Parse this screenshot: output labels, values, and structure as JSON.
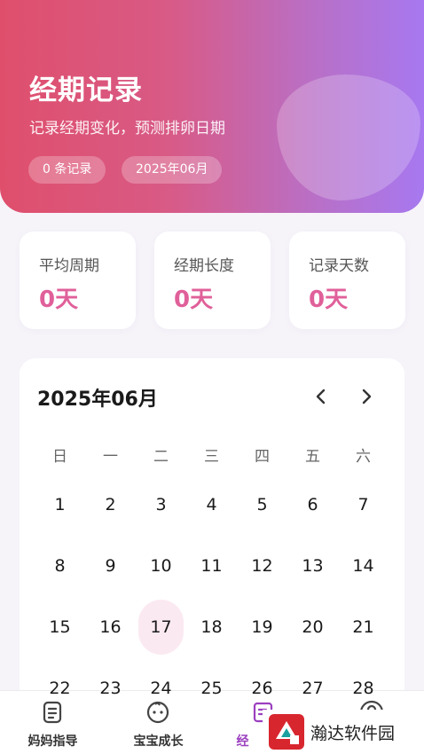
{
  "header": {
    "title": "经期记录",
    "subtitle": "记录经期变化，预测排卵日期",
    "chip_count": "0 条记录",
    "chip_month": "2025年06月"
  },
  "stats": [
    {
      "label": "平均周期",
      "value": "0天"
    },
    {
      "label": "经期长度",
      "value": "0天"
    },
    {
      "label": "记录天数",
      "value": "0天"
    }
  ],
  "calendar": {
    "title": "2025年06月",
    "prev_icon": "chevron-left-icon",
    "next_icon": "chevron-right-icon",
    "weekdays": [
      "日",
      "一",
      "二",
      "三",
      "四",
      "五",
      "六"
    ],
    "weeks": [
      [
        "1",
        "2",
        "3",
        "4",
        "5",
        "6",
        "7"
      ],
      [
        "8",
        "9",
        "10",
        "11",
        "12",
        "13",
        "14"
      ],
      [
        "15",
        "16",
        "17",
        "18",
        "19",
        "20",
        "21"
      ],
      [
        "22",
        "23",
        "24",
        "25",
        "26",
        "27",
        "28"
      ]
    ],
    "today": "17",
    "today_color": "#fbe9f1"
  },
  "nav": [
    {
      "label": "妈妈指导",
      "icon": "document-icon"
    },
    {
      "label": "宝宝成长",
      "icon": "baby-face-icon"
    },
    {
      "label": "经",
      "icon": "edit-note-icon",
      "active": true
    },
    {
      "label": "",
      "icon": "user-icon"
    }
  ],
  "watermark": {
    "text": "瀚达软件园"
  },
  "colors": {
    "accent": "#e0609a",
    "nav_active": "#9b3fbf"
  }
}
